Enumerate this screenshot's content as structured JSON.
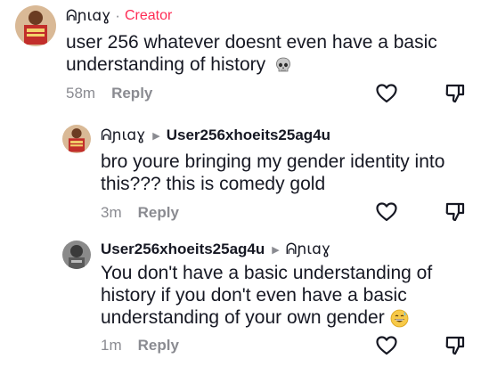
{
  "comments": [
    {
      "author": "ᕱɲɩɑɣ",
      "separator": "·",
      "badge": "Creator",
      "text": "user 256 whatever doesnt even have a basic understanding of history",
      "time": "58m",
      "reply_label": "Reply",
      "emoji": "skull-emoji"
    },
    {
      "author": "ᕱɲɩɑɣ",
      "reply_to": "User256xhoeits25ag4u",
      "text": "bro youre bringing my gender identity into this??? this is comedy gold",
      "time": "3m",
      "reply_label": "Reply"
    },
    {
      "author": "User256xhoeits25ag4u",
      "reply_to": "ᕱɲɩɑɣ",
      "text": "You don't have a basic understanding of history if you don't even have a basic understanding of your own gender",
      "time": "1m",
      "reply_label": "Reply",
      "emoji": "grinning-sweat-emoji"
    }
  ],
  "colors": {
    "text": "#161823",
    "muted": "#8a8b91",
    "creator": "#fe2c55"
  }
}
